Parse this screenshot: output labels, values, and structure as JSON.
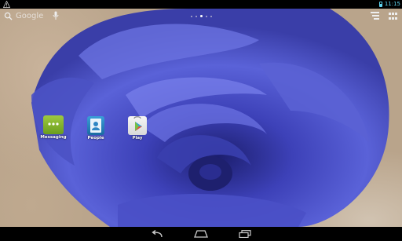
{
  "status_bar": {
    "time": "11:15",
    "icons": [
      "warning-icon",
      "battery-icon"
    ]
  },
  "search": {
    "label": "Google",
    "icons": [
      "search-icon",
      "mic-icon"
    ]
  },
  "top_right": {
    "icons": [
      "widgets-icon",
      "all-apps-icon"
    ]
  },
  "page_indicator": {
    "count": 5,
    "active_index": 2
  },
  "apps": [
    {
      "label": "Messaging",
      "icon": "messaging-icon"
    },
    {
      "label": "People",
      "icon": "people-icon"
    },
    {
      "label": "Play",
      "icon": "play-store-icon"
    }
  ],
  "nav_bar": {
    "buttons": [
      "back-icon",
      "home-icon",
      "recents-icon"
    ]
  },
  "colors": {
    "status_accent": "#5fd4f0",
    "rose": "#4a4fc8",
    "background": "#b9a48b"
  }
}
